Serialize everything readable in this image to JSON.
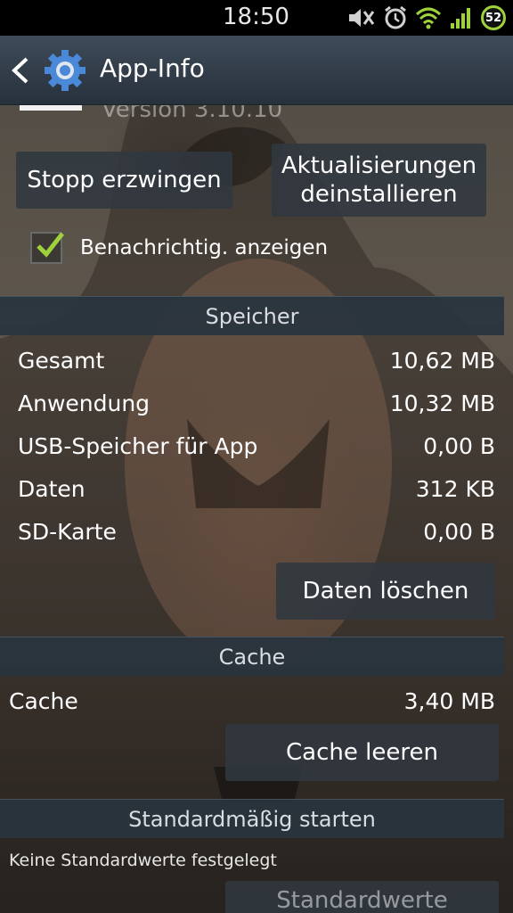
{
  "status_bar": {
    "time": "18:50",
    "battery_level": "52",
    "icons": [
      "mute-icon",
      "alarm-icon",
      "wifi-icon",
      "signal-icon",
      "battery-icon"
    ]
  },
  "action_bar": {
    "title": "App-Info",
    "back_icon": "back-chevron-icon",
    "app_icon": "settings-gear-icon"
  },
  "app": {
    "version": "Version 3.10.10"
  },
  "buttons": {
    "force_stop": "Stopp erzwingen",
    "uninstall_updates_line1": "Aktualisierungen",
    "uninstall_updates_line2": "deinstallieren",
    "clear_data": "Daten löschen",
    "clear_cache": "Cache leeren",
    "clear_defaults": "Standardwerte"
  },
  "notifications": {
    "label": "Benachrichtig. anzeigen",
    "checked": true
  },
  "storage": {
    "header": "Speicher",
    "rows": [
      {
        "label": "Gesamt",
        "value": "10,62 MB"
      },
      {
        "label": "Anwendung",
        "value": "10,32 MB"
      },
      {
        "label": "USB-Speicher für App",
        "value": "0,00 B"
      },
      {
        "label": "Daten",
        "value": "312 KB"
      },
      {
        "label": "SD-Karte",
        "value": "0,00 B"
      }
    ]
  },
  "cache": {
    "header": "Cache",
    "label": "Cache",
    "value": "3,40 MB"
  },
  "launch_default": {
    "header": "Standardmäßig starten",
    "info": "Keine Standardwerte festgelegt"
  },
  "colors": {
    "accent_check": "#9fd23a",
    "section_header_bg": "#28343e",
    "button_bg": "#303840",
    "action_bar_bg": "#3f4b59"
  }
}
